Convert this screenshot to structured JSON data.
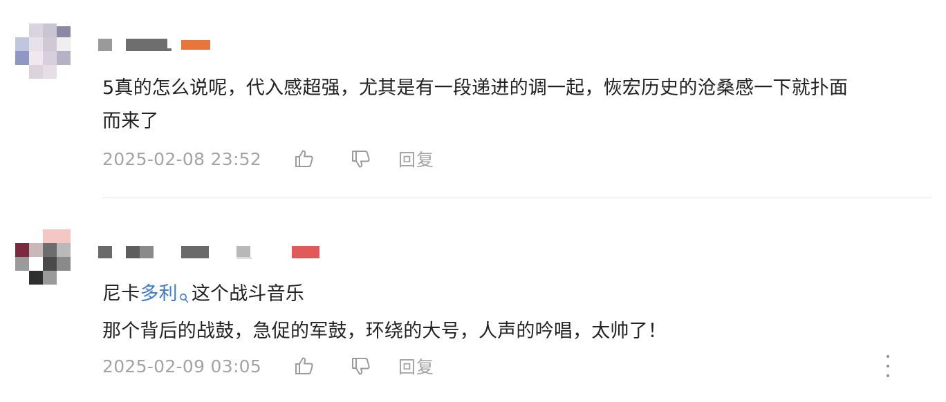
{
  "comments": [
    {
      "content_lines": [
        "5真的怎么说呢，代入感超强，尤其是有一段递进的调一起，恢宏历史的沧桑感一下就扑面",
        "而来了"
      ],
      "timestamp": "2025-02-08 23:52",
      "reply_label": "回复",
      "badge_color": "#e8763a"
    },
    {
      "content_prefix": "尼卡",
      "content_link": "多利",
      "content_suffix": "这个战斗音乐",
      "content_line2": "那个背后的战鼓，急促的军鼓，环绕的大号，人声的吟唱，太帅了！",
      "timestamp": "2025-02-09 03:05",
      "reply_label": "回复",
      "badge_color": "#e05a5a"
    }
  ],
  "icons": {
    "like": "thumbs-up-icon",
    "dislike": "thumbs-down-icon",
    "search": "search-icon",
    "more": "more-vertical-icon"
  },
  "colors": {
    "text": "#222222",
    "meta": "#a3a3a3",
    "link": "#3d7cc9"
  }
}
